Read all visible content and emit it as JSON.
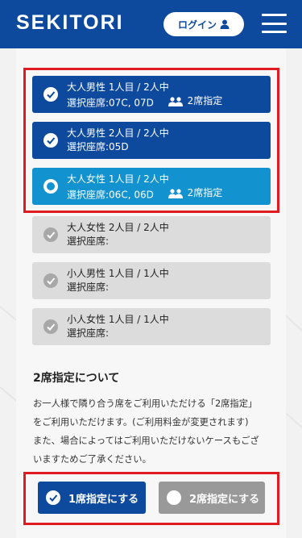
{
  "header": {
    "logo": "SEKITORI",
    "login_label": "ログイン"
  },
  "passengers": [
    {
      "line1": "大人男性 1人目 / 2人中",
      "seats": "選択座席:07C, 07D",
      "extra": "2席指定",
      "state": "done"
    },
    {
      "line1": "大人男性 2人目 / 2人中",
      "seats": "選択座席:05D",
      "extra": "",
      "state": "done"
    },
    {
      "line1": "大人女性 1人目 / 2人中",
      "seats": "選択座席:06C, 06D",
      "extra": "2席指定",
      "state": "active"
    },
    {
      "line1": "大人女性 2人目 / 2人中",
      "seats": "選択座席:",
      "extra": "",
      "state": "pending"
    },
    {
      "line1": "小人男性 1人目 / 1人中",
      "seats": "選択座席:",
      "extra": "",
      "state": "pending"
    },
    {
      "line1": "小人女性 1人目 / 1人中",
      "seats": "選択座席:",
      "extra": "",
      "state": "pending"
    }
  ],
  "info": {
    "title": "2席指定について",
    "body_line1": "お一人様で隣り合う席をご利用いただける「2席指定」",
    "body_line2": "をご利用いただけます。(ご利用料金が変更されます)",
    "body_line3": "また、場合によってはご利用いただけないケースもござ",
    "body_line4": "いますためご了承ください。"
  },
  "buttons": {
    "single_label": "1席指定にする",
    "double_label": "2席指定にする"
  },
  "colors": {
    "brand": "#0d4a9e",
    "active": "#1292cf",
    "pending": "#dcdcdc",
    "highlight": "#e01b22"
  }
}
